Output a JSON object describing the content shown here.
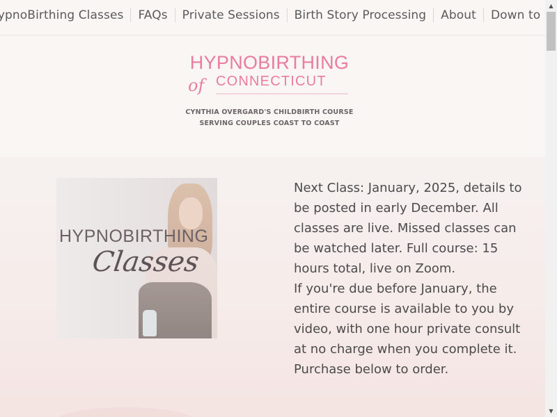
{
  "nav": {
    "items": [
      "HypnoBirthing Classes",
      "FAQs",
      "Private Sessions",
      "Birth Story Processing",
      "About",
      "Down to Birth Podcast"
    ]
  },
  "logo": {
    "line1": "HYPNOBIRTHING",
    "of": "of",
    "line2": "CONNECTICUT",
    "tagline1": "CYNTHIA OVERGARD'S CHILDBIRTH COURSE",
    "tagline2": "SERVING COUPLES COAST TO COAST",
    "colors": {
      "pink": "#e97ca0",
      "gray": "#6d6468"
    }
  },
  "image": {
    "title": "HYPNOBIRTHING",
    "script": "Classes"
  },
  "description": {
    "para1": "Next Class: January, 2025, details to be posted in early December. All classes are live. Missed classes can be watched later. Full course: 15 hours total, live on Zoom.",
    "para2": "If you're due before January, the entire course is available to you by video, with one hour private consult at no charge when you complete it. Purchase below to order."
  },
  "scrollbar": {
    "up_icon": "triangle-up-icon",
    "down_icon": "triangle-down-icon"
  }
}
